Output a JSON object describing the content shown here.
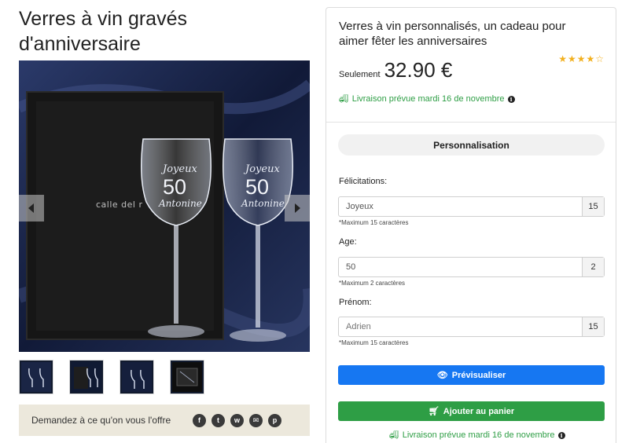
{
  "product": {
    "title": "Verres à vin gravés d'anniversaire",
    "subtitle": "Verres à vin personnalisés, un cadeau pour aimer fêter les anniversaires",
    "price_prefix": "Seulement",
    "price": "32.90 €",
    "rating": 4,
    "rating_max": 5,
    "stars_text": "★★★★☆",
    "delivery": "Livraison prévue mardi 16 de novembre"
  },
  "image": {
    "box_brand": "calle del r",
    "glass_left": {
      "line1": "Joyeux",
      "line2": "50",
      "line3": "Antonine"
    },
    "glass_right": {
      "line1": "Joyeux",
      "line2": "50",
      "line3": "Antonine"
    }
  },
  "share": {
    "text": "Demandez à ce qu'on vous l'offre",
    "icons": [
      {
        "name": "facebook-icon",
        "glyph": "f"
      },
      {
        "name": "twitter-icon",
        "glyph": "t"
      },
      {
        "name": "whatsapp-icon",
        "glyph": "w"
      },
      {
        "name": "email-icon",
        "glyph": "✉"
      },
      {
        "name": "pinterest-icon",
        "glyph": "p"
      }
    ]
  },
  "personalisation": {
    "header": "Personnalisation",
    "fields": [
      {
        "label": "Félicitations:",
        "value": "Joyeux",
        "count": "15",
        "hint": "*Maximum 15 caractères"
      },
      {
        "label": "Age:",
        "value": "50",
        "count": "2",
        "hint": "*Maximum 2 caractères"
      },
      {
        "label": "Prénom:",
        "placeholder": "Adrien",
        "count": "15",
        "hint": "*Maximum 15 caractères"
      }
    ]
  },
  "actions": {
    "preview_label": "Prévisualiser",
    "cart_label": "Ajouter au panier"
  },
  "colors": {
    "green": "#2e9e45",
    "blue": "#1677f2",
    "star": "#f2b01e"
  }
}
